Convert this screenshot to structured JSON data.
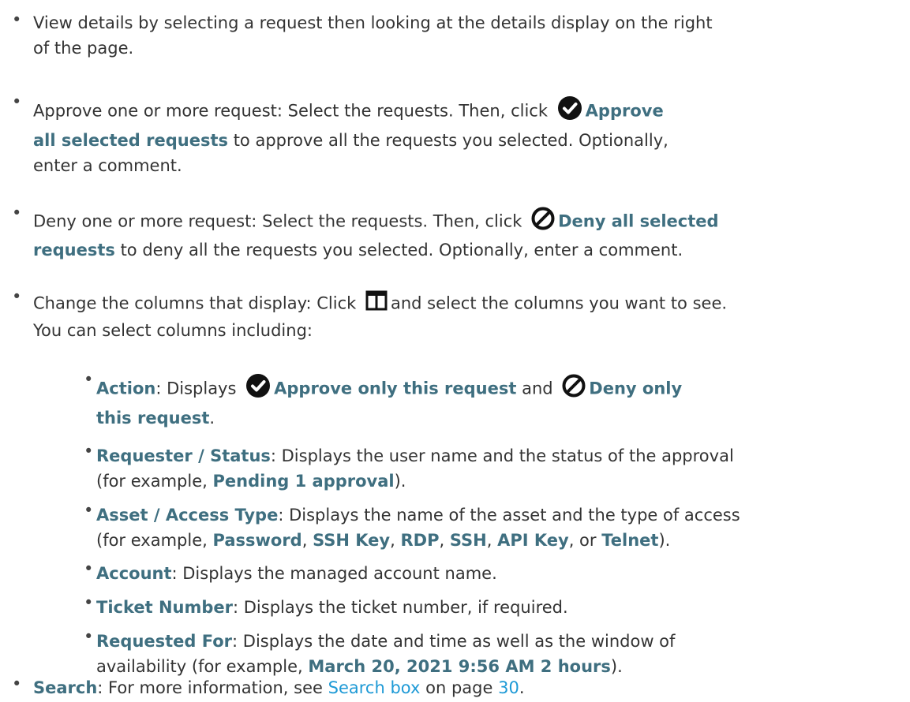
{
  "colors": {
    "text": "#333333",
    "bold": "#3f6f80",
    "link": "#1e9ad6"
  },
  "items": [
    {
      "a": "View details by selecting a request then looking at the details display on the right",
      "b": "of the page."
    },
    {
      "a": "Approve one or more request: Select the requests. Then, click",
      "bold1": "Approve",
      "bold2": "all selected requests",
      "b": "to approve all the requests you selected. Optionally,",
      "c": "enter a comment."
    },
    {
      "a": "Deny one or more request: Select the requests. Then, click",
      "bold1": "Deny all selected",
      "bold2": "requests",
      "b": "to deny all the requests you selected. Optionally, enter a comment."
    },
    {
      "a": "Change the columns that display: Click",
      "b": "and select the columns you want to see.",
      "c": "You can select columns including:"
    }
  ],
  "subitems": [
    {
      "label": "Action",
      "a": ": Displays",
      "bold1": "Approve only this request",
      "b": "and",
      "bold2": "Deny only",
      "bold3": "this request",
      "c": "."
    },
    {
      "label": "Requester / Status",
      "a": ": Displays the user name and the status of the approval",
      "b": "(for example,",
      "bold1": "Pending 1 approval",
      "c": ")."
    },
    {
      "label": "Asset / Access Type",
      "a": ": Displays the name of the asset and the type of access",
      "b": "(for example,",
      "t1": "Password",
      "t2": "SSH Key",
      "t3": "RDP",
      "t4": "SSH",
      "t5": "API Key",
      "or": "or",
      "t6": "Telnet",
      "c": ")."
    },
    {
      "label": "Account",
      "a": ": Displays the managed account name."
    },
    {
      "label": "Ticket Number",
      "a": ": Displays the ticket number, if required."
    },
    {
      "label": "Requested For",
      "a": ": Displays the date and time as well as the window of",
      "b": "availability (for example,",
      "bold1": "March 20, 2021 9:56 AM 2 hours",
      "c": ")."
    }
  ],
  "search": {
    "label": "Search",
    "a": ": For more information, see",
    "link1": "Search box",
    "b": "on page",
    "link2": "30",
    "c": "."
  },
  "icons": {
    "approve": "check-circle-icon",
    "deny": "deny-circle-icon",
    "columns": "columns-icon"
  }
}
